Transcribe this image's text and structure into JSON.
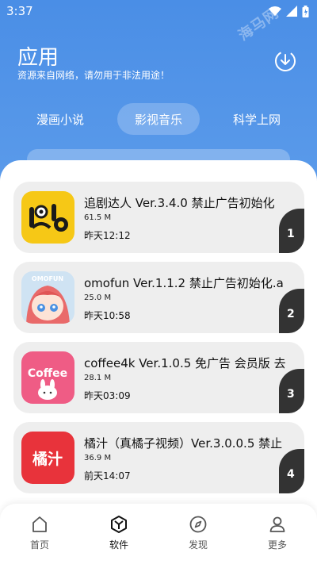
{
  "statusbar": {
    "time": "3:37"
  },
  "header": {
    "title": "应用",
    "subtitle": "资源来自网络，请勿用于非法用途！",
    "download_icon": "download-icon",
    "watermark": "海马网"
  },
  "tabs": [
    {
      "label": "漫画小说",
      "active": false
    },
    {
      "label": "影视音乐",
      "active": true
    },
    {
      "label": "科学上网",
      "active": false
    }
  ],
  "apps": [
    {
      "title": "追剧达人 Ver.3.4.0 禁止广告初始化",
      "size": "61.5 M",
      "date": "昨天12:12",
      "rank": "1",
      "icon": "zhuiju-icon",
      "color": "#f5c518"
    },
    {
      "title": "omofun Ver.1.1.2 禁止广告初始化.a",
      "size": "25.0 M",
      "date": "昨天10:58",
      "rank": "2",
      "icon": "omofun-icon",
      "color": "#e96a6a"
    },
    {
      "title": "coffee4k Ver.1.0.5 免广告 会员版 去",
      "size": "28.1 M",
      "date": "昨天03:09",
      "rank": "3",
      "icon": "coffee4k-icon",
      "color": "#ef5c85"
    },
    {
      "title": "橘汁（真橘子视频）Ver.3.0.0.5 禁止",
      "size": "36.9 M",
      "date": "前天14:07",
      "rank": "4",
      "icon": "juzhi-icon",
      "color": "#e8333b"
    }
  ],
  "icon_texts": {
    "omofun": "OMOFUN",
    "coffee": "Coffee",
    "juzhi": "橘汁"
  },
  "nav": [
    {
      "label": "首页",
      "icon": "home-icon"
    },
    {
      "label": "软件",
      "icon": "box-icon",
      "active": true
    },
    {
      "label": "发现",
      "icon": "compass-icon"
    },
    {
      "label": "更多",
      "icon": "person-icon"
    }
  ]
}
